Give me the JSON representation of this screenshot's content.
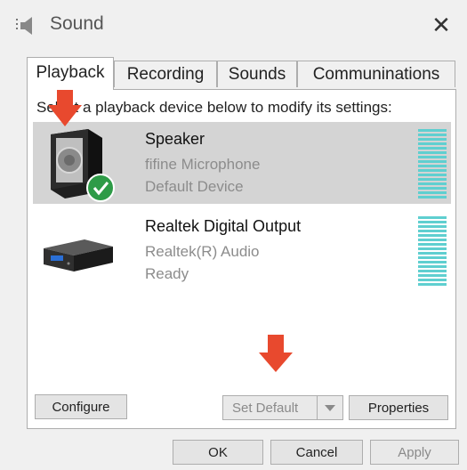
{
  "window": {
    "title": "Sound",
    "icon": "speaker-icon",
    "close_icon": "close-icon",
    "close_glyph": "✕"
  },
  "tabs": [
    {
      "label": "Playback",
      "active": true
    },
    {
      "label": "Recording",
      "active": false
    },
    {
      "label": "Sounds",
      "active": false
    },
    {
      "label": "Communinations",
      "active": false
    }
  ],
  "instruction": "Select a playback device below to modify its settings:",
  "devices": [
    {
      "name": "Speaker",
      "description": "fifine Microphone",
      "status": "Default Device",
      "selected": true,
      "is_default": true,
      "icon": "speaker-device-icon"
    },
    {
      "name": "Realtek Digital Output",
      "description": "Realtek(R) Audio",
      "status": "Ready",
      "selected": false,
      "is_default": false,
      "icon": "digital-output-device-icon"
    }
  ],
  "buttons": {
    "configure": "Configure",
    "set_default": "Set Default",
    "properties": "Properties",
    "ok": "OK",
    "cancel": "Cancel",
    "apply": "Apply"
  },
  "colors": {
    "level_meter": "#5fcfd0",
    "selection": "#d4d4d4",
    "default_check": "#2e9b47",
    "annotation_arrow": "#e8492e"
  }
}
